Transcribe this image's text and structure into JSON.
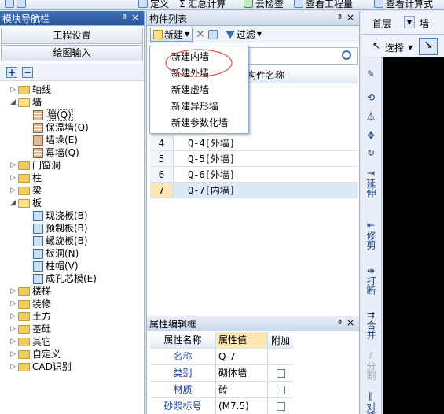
{
  "top_toolbar": {
    "items": [
      "定义",
      "Σ 汇总计算",
      "云检查",
      "查看工程量",
      "查看计算式"
    ]
  },
  "nav_panel": {
    "title": "模块导航栏",
    "pin": "ª",
    "close": "×",
    "buttons": [
      "工程设置",
      "绘图输入"
    ],
    "add": "+",
    "remove": "−",
    "tree": [
      {
        "label": "轴线",
        "level": 0,
        "expander": "▷",
        "type": "folder"
      },
      {
        "label": "墙",
        "level": 0,
        "expander": "◢",
        "type": "folder-open"
      },
      {
        "label": "墙(Q)",
        "level": 1,
        "type": "leaf",
        "selected": true
      },
      {
        "label": "保温墙(Q)",
        "level": 1,
        "type": "leaf"
      },
      {
        "label": "墙垛(E)",
        "level": 1,
        "type": "leaf"
      },
      {
        "label": "幕墙(Q)",
        "level": 1,
        "type": "leaf"
      },
      {
        "label": "门窗洞",
        "level": 0,
        "expander": "▷",
        "type": "folder"
      },
      {
        "label": "柱",
        "level": 0,
        "expander": "▷",
        "type": "folder"
      },
      {
        "label": "梁",
        "level": 0,
        "expander": "▷",
        "type": "folder"
      },
      {
        "label": "板",
        "level": 0,
        "expander": "◢",
        "type": "folder-open"
      },
      {
        "label": "现浇板(B)",
        "level": 1,
        "type": "leaf-blue"
      },
      {
        "label": "预制板(B)",
        "level": 1,
        "type": "leaf-blue"
      },
      {
        "label": "螺旋板(B)",
        "level": 1,
        "type": "leaf-blue"
      },
      {
        "label": "板洞(N)",
        "level": 1,
        "type": "leaf-blue"
      },
      {
        "label": "柱帽(V)",
        "level": 1,
        "type": "leaf-blue"
      },
      {
        "label": "成孔芯模(E)",
        "level": 1,
        "type": "leaf-blue"
      },
      {
        "label": "楼梯",
        "level": 0,
        "expander": "▷",
        "type": "folder"
      },
      {
        "label": "装修",
        "level": 0,
        "expander": "▷",
        "type": "folder"
      },
      {
        "label": "土方",
        "level": 0,
        "expander": "▷",
        "type": "folder"
      },
      {
        "label": "基础",
        "level": 0,
        "expander": "▷",
        "type": "folder"
      },
      {
        "label": "其它",
        "level": 0,
        "expander": "▷",
        "type": "folder"
      },
      {
        "label": "自定义",
        "level": 0,
        "expander": "▷",
        "type": "folder"
      },
      {
        "label": "CAD识别",
        "level": 0,
        "expander": "▷",
        "type": "folder"
      }
    ]
  },
  "component_list": {
    "title": "构件列表",
    "pin": "ª",
    "close": "×",
    "new_button": "新建",
    "delete": "✕",
    "filter_button": "过滤",
    "column_header": "构件名称",
    "search_icon": "search-icon",
    "rows": [
      {
        "num": "4",
        "name": "Q-4[外墙]"
      },
      {
        "num": "5",
        "name": "Q-5[外墙]"
      },
      {
        "num": "6",
        "name": "Q-6[外墙]"
      },
      {
        "num": "7",
        "name": "Q-7[内墙]",
        "selected": true
      }
    ]
  },
  "new_menu": {
    "items": [
      "新建内墙",
      "新建外墙",
      "新建虚墙",
      "新建异形墙",
      "新建参数化墙"
    ],
    "highlight_color": "#d9534f"
  },
  "props_panel": {
    "title": "属性编辑框",
    "pin": "ª",
    "close": "×",
    "headers": [
      "属性名称",
      "属性值",
      "附加"
    ],
    "rows": [
      {
        "name": "名称",
        "value": "Q-7",
        "checkbox": false
      },
      {
        "name": "类别",
        "value": "砌体墙",
        "checkbox": true
      },
      {
        "name": "材质",
        "value": "砖",
        "checkbox": true
      },
      {
        "name": "砂浆标号",
        "value": "(M7.5)",
        "checkbox": true
      }
    ]
  },
  "right_panel": {
    "floor_label": "首层",
    "type_select": "墙",
    "select_tool": "选择",
    "vertical_tools": [
      "延伸",
      "修剪",
      "打断",
      "合并",
      "分割",
      "对齐"
    ]
  }
}
